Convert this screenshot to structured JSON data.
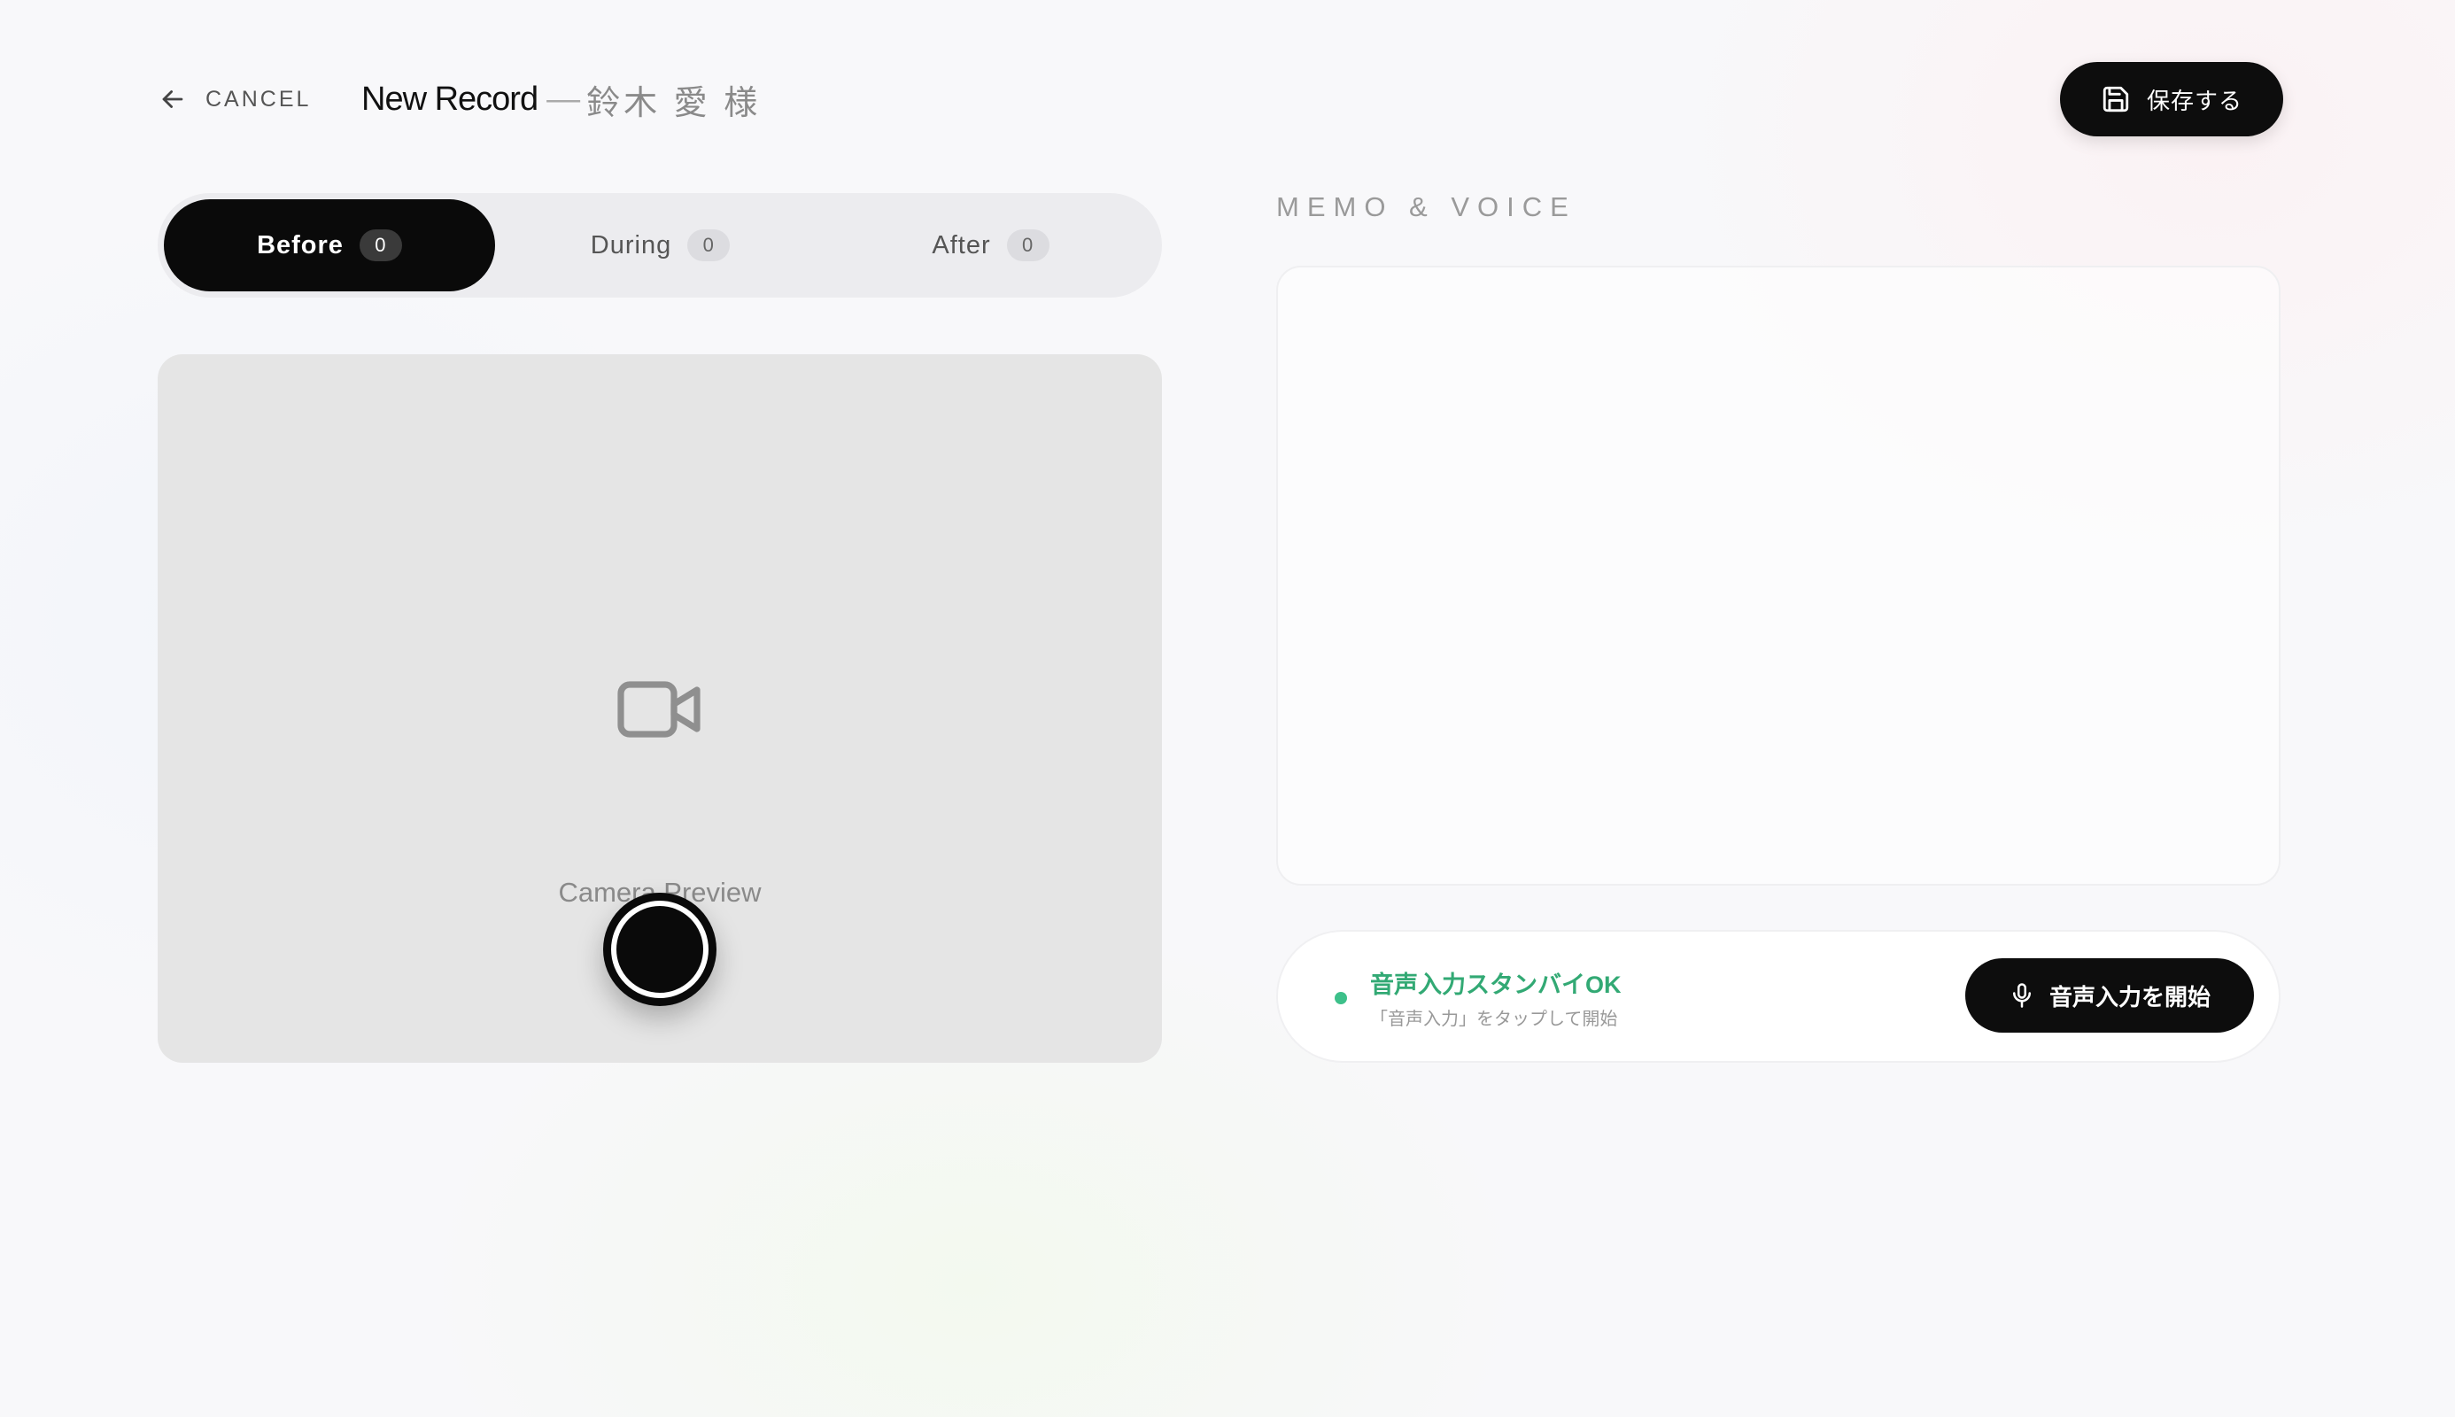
{
  "header": {
    "cancel_label": "CANCEL",
    "title_main": "New Record",
    "title_separator": "—",
    "client_name": "鈴木 愛 様",
    "save_label": "保存する"
  },
  "tabs": [
    {
      "label": "Before",
      "count": "0",
      "active": true
    },
    {
      "label": "During",
      "count": "0",
      "active": false
    },
    {
      "label": "After",
      "count": "0",
      "active": false
    }
  ],
  "camera": {
    "preview_label": "Camera Preview",
    "icon": "video-camera-icon"
  },
  "memo": {
    "section_label": "MEMO & VOICE",
    "placeholder": "",
    "value": ""
  },
  "voice": {
    "status": "音声入力スタンバイOK",
    "hint": "「音声入力」をタップして開始",
    "start_label": "音声入力を開始",
    "status_color": "#32a974"
  },
  "colors": {
    "accent": "#0d0d0d",
    "ready": "#3dc08a"
  }
}
